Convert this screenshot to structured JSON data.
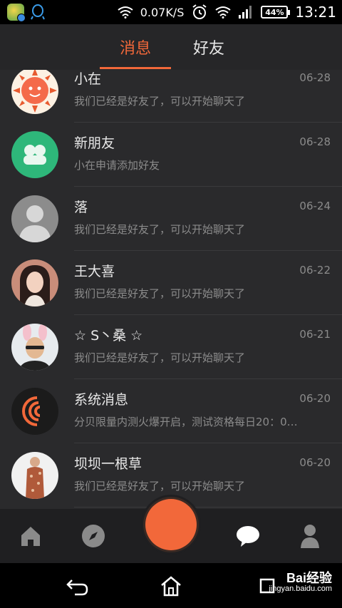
{
  "status_bar": {
    "speed": "0.07K/S",
    "battery": "44%",
    "time": "13:21"
  },
  "tabs": [
    {
      "label": "消息",
      "active": true
    },
    {
      "label": "好友",
      "active": false
    }
  ],
  "accent_color": "#f2683a",
  "messages": [
    {
      "name": "小在",
      "date": "06-28",
      "preview": "我们已经是好友了，可以开始聊天了",
      "avatar": "sun-avatar"
    },
    {
      "name": "新朋友",
      "date": "06-28",
      "preview": "小在申请添加好友",
      "avatar": "new-friend-icon"
    },
    {
      "name": "落",
      "date": "06-24",
      "preview": "我们已经是好友了，可以开始聊天了",
      "avatar": "default-avatar"
    },
    {
      "name": "王大喜",
      "date": "06-22",
      "preview": "我们已经是好友了，可以开始聊天了",
      "avatar": "photo-avatar"
    },
    {
      "name": "☆ S丶桑 ☆",
      "date": "06-21",
      "preview": "我们已经是好友了，可以开始聊天了",
      "avatar": "photo-avatar"
    },
    {
      "name": "系统消息",
      "date": "06-20",
      "preview": "分贝限量内测火爆开启，测试资格每日20：0…",
      "avatar": "system-logo-icon"
    },
    {
      "name": "坝坝一根草",
      "date": "06-20",
      "preview": "我们已经是好友了，可以开始聊天了",
      "avatar": "photo-avatar"
    }
  ],
  "bottom_nav": [
    "home-icon",
    "compass-icon",
    "record-button",
    "chat-icon",
    "profile-icon"
  ],
  "watermark": {
    "main": "Bai经验",
    "sub": "jingyan.baidu.com"
  }
}
